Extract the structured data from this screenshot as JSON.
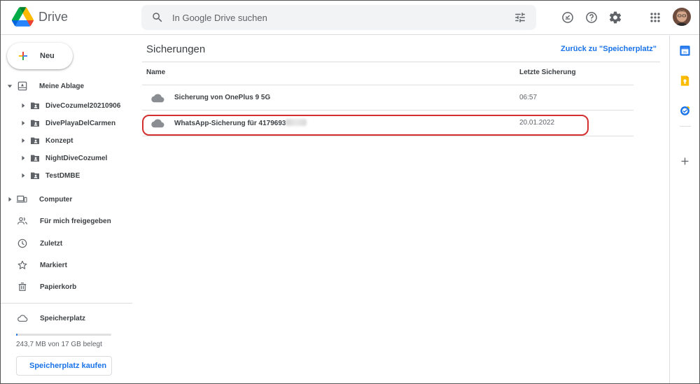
{
  "app": {
    "name": "Drive"
  },
  "search": {
    "placeholder": "In Google Drive suchen",
    "value": ""
  },
  "header_icons": [
    "offline-check-icon",
    "help-icon",
    "settings-icon",
    "apps-grid-icon"
  ],
  "sidebar": {
    "new_label": "Neu",
    "my_drive": {
      "label": "Meine Ablage",
      "folders": [
        "DiveCozumel20210906",
        "DivePlayaDelCarmen",
        "Konzept",
        "NightDiveCozumel",
        "TestDMBE"
      ]
    },
    "items": [
      {
        "label": "Computer",
        "icon": "computer-icon"
      },
      {
        "label": "Für mich freigegeben",
        "icon": "shared-icon"
      },
      {
        "label": "Zuletzt",
        "icon": "clock-icon"
      },
      {
        "label": "Markiert",
        "icon": "star-icon"
      },
      {
        "label": "Papierkorb",
        "icon": "trash-icon"
      }
    ],
    "storage": {
      "label": "Speicherplatz",
      "usage_text": "243,7 MB von 17 GB belegt",
      "used_fraction": 0.014,
      "buy_label": "Speicherplatz kaufen"
    }
  },
  "main": {
    "title": "Sicherungen",
    "back_link": "Zurück zu \"Speicherplatz\"",
    "columns": {
      "name": "Name",
      "last_backup": "Letzte Sicherung"
    },
    "rows": [
      {
        "name": "Sicherung von OnePlus 9 5G",
        "date": "06:57",
        "icon": "cloud-icon"
      },
      {
        "name": "WhatsApp-Sicherung für 4179693",
        "date": "20.01.2022",
        "icon": "cloud-icon",
        "highlighted": true
      }
    ]
  },
  "rail_icons": [
    "calendar-icon",
    "keep-icon",
    "tasks-icon",
    "add-icon"
  ],
  "colors": {
    "accent": "#1a73e8",
    "highlight": "#d32f2f",
    "icon_gray": "#5f6368"
  }
}
